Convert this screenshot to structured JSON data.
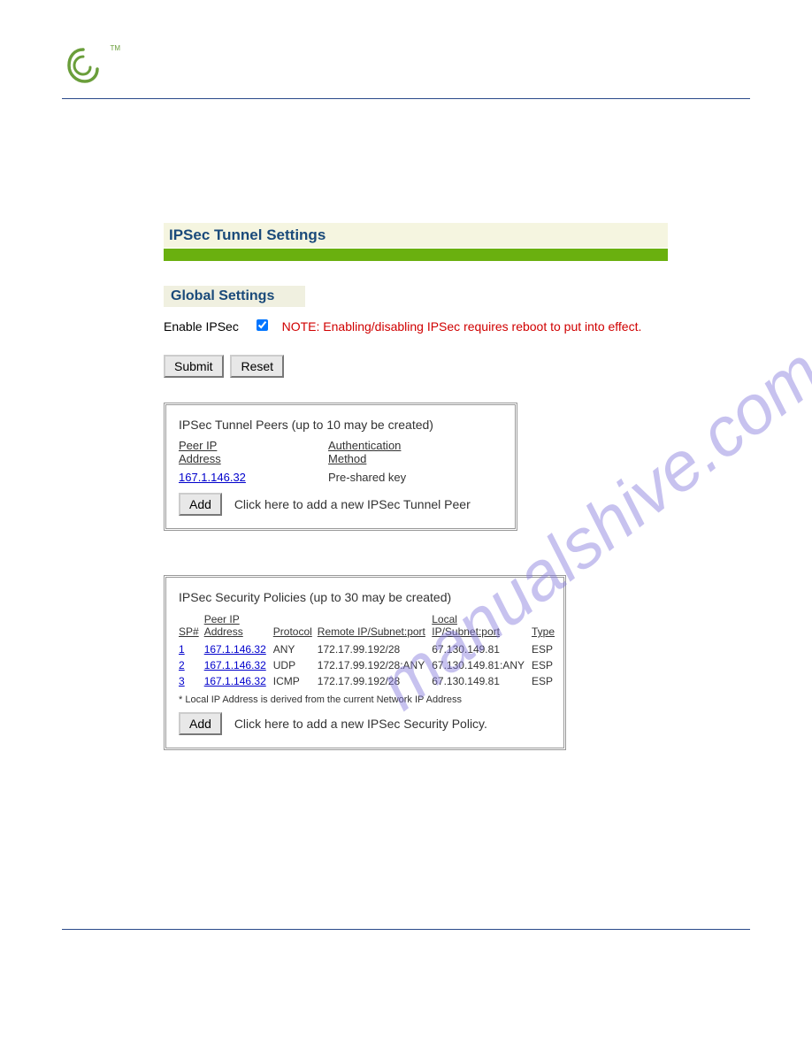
{
  "logo_tm": "TM",
  "page_title": "IPSec Tunnel Settings",
  "global_settings_title": "Global Settings",
  "enable_label": "Enable IPSec",
  "enable_checked": true,
  "enable_note": "NOTE: Enabling/disabling IPSec requires reboot to put into effect.",
  "submit_label": "Submit",
  "reset_label": "Reset",
  "peers": {
    "title": "IPSec Tunnel Peers (up to 10 may be created)",
    "col_peer_ip": "Peer IP Address",
    "col_auth": "Authentication Method",
    "rows": [
      {
        "ip": "167.1.146.32",
        "auth": "Pre-shared key"
      }
    ],
    "add_label": "Add",
    "add_text": "Click here to add a new IPSec Tunnel Peer"
  },
  "policies": {
    "title": "IPSec Security Policies (up to 30 may be created)",
    "col_sp": "SP#",
    "col_peer_ip": "Peer IP Address",
    "col_protocol": "Protocol",
    "col_remote": "Remote IP/Subnet:port",
    "col_local": "Local IP/Subnet:port",
    "col_type": "Type",
    "rows": [
      {
        "sp": "1",
        "ip": "167.1.146.32",
        "proto": "ANY",
        "remote": "172.17.99.192/28",
        "local": "67.130.149.81",
        "type": "ESP"
      },
      {
        "sp": "2",
        "ip": "167.1.146.32",
        "proto": "UDP",
        "remote": "172.17.99.192/28:ANY",
        "local": "67.130.149.81:ANY",
        "type": "ESP"
      },
      {
        "sp": "3",
        "ip": "167.1.146.32",
        "proto": "ICMP",
        "remote": "172.17.99.192/28",
        "local": "67.130.149.81",
        "type": "ESP"
      }
    ],
    "footnote": "* Local IP Address is derived from the current Network IP Address",
    "add_label": "Add",
    "add_text": "Click here to add a new IPSec Security Policy."
  },
  "watermark": "manualshive.com"
}
